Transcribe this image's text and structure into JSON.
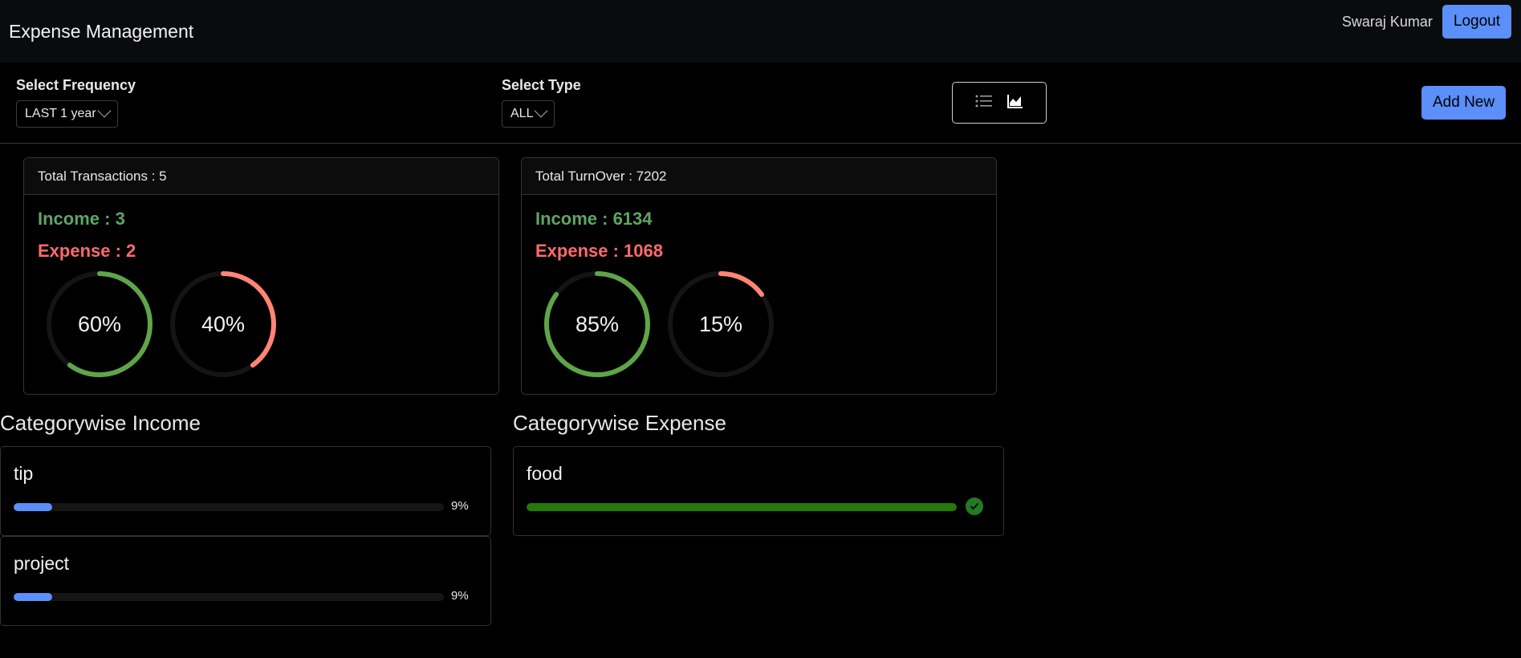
{
  "navbar": {
    "brand": "Expense Management",
    "user": "Swaraj Kumar",
    "logout_label": "Logout"
  },
  "filters": {
    "frequency_label": "Select Frequency",
    "frequency_value": "LAST 1 year",
    "type_label": "Select Type",
    "type_value": "ALL",
    "view_icons": [
      "list-icon",
      "area-chart-icon"
    ],
    "add_label": "Add New"
  },
  "summary": {
    "transactions": {
      "header": "Total Transactions : 5",
      "income": "Income : 3",
      "expense": "Expense : 2",
      "income_pct": 60,
      "expense_pct": 40,
      "income_pct_label": "60%",
      "expense_pct_label": "40%"
    },
    "turnover": {
      "header": "Total TurnOver : 7202",
      "income": "Income : 6134",
      "expense": "Expense : 1068",
      "income_pct": 85,
      "expense_pct": 15,
      "income_pct_label": "85%",
      "expense_pct_label": "15%"
    }
  },
  "categories": {
    "income_title": "Categorywise Income",
    "expense_title": "Categorywise Expense",
    "income": [
      {
        "name": "tip",
        "pct": 9,
        "pct_label": "9%"
      },
      {
        "name": "project",
        "pct": 9,
        "pct_label": "9%"
      }
    ],
    "expense": [
      {
        "name": "food",
        "pct": 100,
        "status": "check-icon"
      }
    ]
  },
  "colors": {
    "accent": "#5b8ff9",
    "income": "#5fa565",
    "expense": "#ff6b6b",
    "ring_income": "#5fa548",
    "ring_expense": "#ff8575",
    "bar_income": "#5b8ff9",
    "bar_expense": "#237a08"
  }
}
